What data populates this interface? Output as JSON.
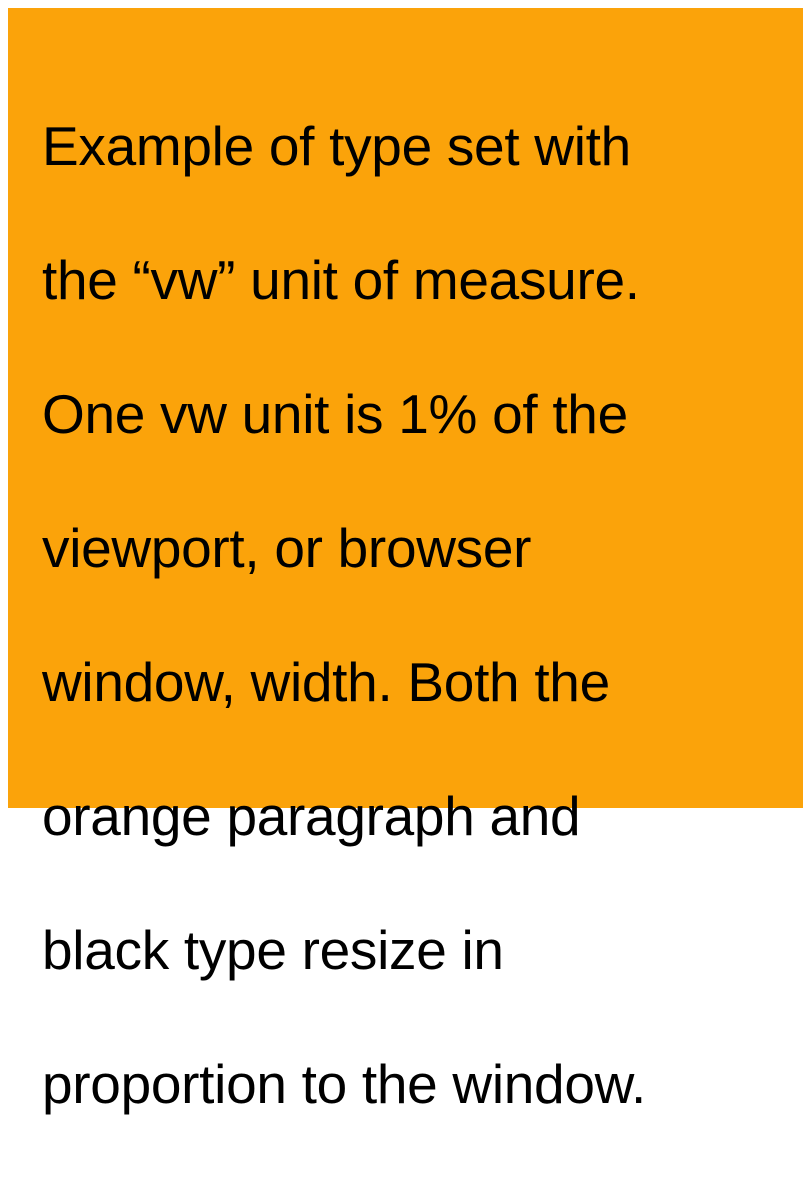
{
  "page": {
    "background_color": "#ffffff",
    "panel_color": "#fba30a",
    "text_color": "#000000"
  },
  "paragraph": {
    "lines": [
      "Example of type set with",
      "the “vw” unit of measure.",
      "One vw unit is 1% of the",
      "viewport, or browser",
      "window, width. Both the",
      "orange paragraph and",
      "black type resize in",
      "proportion to the window."
    ]
  }
}
